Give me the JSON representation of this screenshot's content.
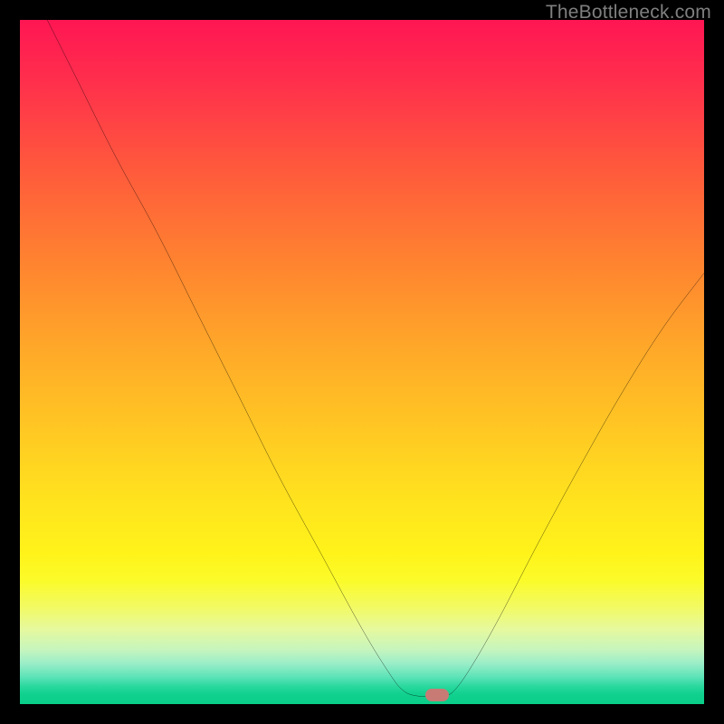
{
  "watermark": "TheBottleneck.com",
  "colors": {
    "frame": "#000000",
    "curve": "#000000",
    "marker": "#c77b74"
  },
  "chart_data": {
    "type": "line",
    "title": "",
    "xlabel": "",
    "ylabel": "",
    "xlim": [
      0,
      100
    ],
    "ylim": [
      0,
      100
    ],
    "grid": false,
    "curve": [
      {
        "x": 4.0,
        "y": 100.0
      },
      {
        "x": 8.0,
        "y": 92.0
      },
      {
        "x": 14.0,
        "y": 80.0
      },
      {
        "x": 20.0,
        "y": 69.0
      },
      {
        "x": 26.0,
        "y": 57.0
      },
      {
        "x": 32.0,
        "y": 45.0
      },
      {
        "x": 38.0,
        "y": 33.0
      },
      {
        "x": 44.0,
        "y": 22.0
      },
      {
        "x": 50.0,
        "y": 11.0
      },
      {
        "x": 54.0,
        "y": 4.5
      },
      {
        "x": 56.0,
        "y": 2.0
      },
      {
        "x": 58.0,
        "y": 1.2
      },
      {
        "x": 60.5,
        "y": 1.2
      },
      {
        "x": 62.0,
        "y": 1.2
      },
      {
        "x": 63.5,
        "y": 2.0
      },
      {
        "x": 66.0,
        "y": 5.5
      },
      {
        "x": 70.0,
        "y": 12.5
      },
      {
        "x": 76.0,
        "y": 24.0
      },
      {
        "x": 82.0,
        "y": 35.0
      },
      {
        "x": 88.0,
        "y": 45.5
      },
      {
        "x": 94.0,
        "y": 55.0
      },
      {
        "x": 100.0,
        "y": 63.0
      }
    ],
    "marker": {
      "x": 61.0,
      "y": 1.3
    }
  }
}
